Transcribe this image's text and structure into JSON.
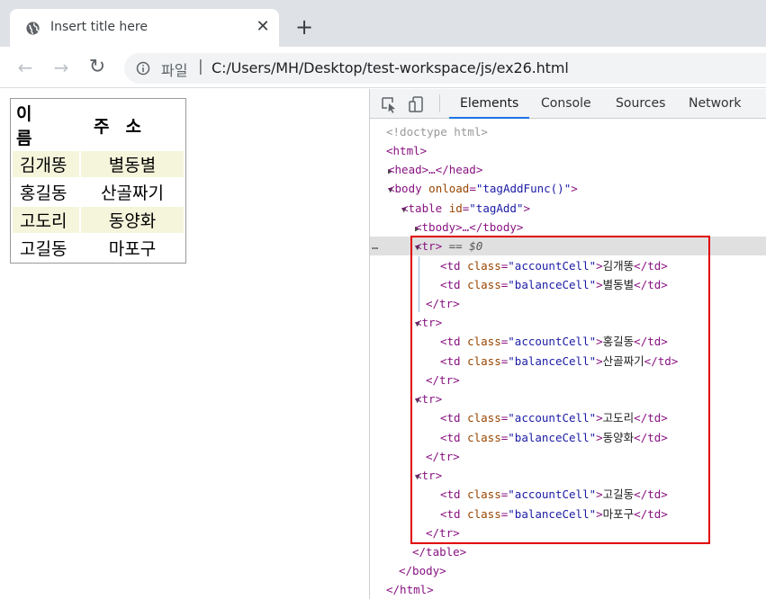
{
  "browser": {
    "tab_title": "Insert title here",
    "close_glyph": "✕",
    "newtab_glyph": "+",
    "back_glyph": "←",
    "forward_glyph": "→",
    "reload_glyph": "↻",
    "protocol_label": "파일",
    "separator": "|",
    "url": "C:/Users/MH/Desktop/test-workspace/js/ex26.html"
  },
  "page_table": {
    "headers": [
      "이름",
      "주소"
    ],
    "rows": [
      {
        "account": "김개똥",
        "balance": "별동별"
      },
      {
        "account": "홍길동",
        "balance": "산골짜기"
      },
      {
        "account": "고도리",
        "balance": "동양화"
      },
      {
        "account": "고길동",
        "balance": "마포구"
      }
    ]
  },
  "devtools": {
    "tabs": [
      "Elements",
      "Console",
      "Sources",
      "Network"
    ],
    "active_tab": "Elements",
    "dom": {
      "doctype": "<!doctype html>",
      "html_open": "<html>",
      "head": "<head>…</head>",
      "body_open_tag": "<body",
      "body_attr": "onload",
      "body_value": "\"tagAddFunc()\"",
      "table_open_tag": "<table",
      "table_attr": "id",
      "table_value": "\"tagAdd\"",
      "tbody": "<tbody>…</tbody>",
      "selected_marker": "== $0",
      "dots": "…",
      "tr_open": "<tr>",
      "tr_close": "</tr>",
      "td_open": "<td",
      "td_close": "</td>",
      "class_attr": "class",
      "account_class": "\"accountCell\"",
      "balance_class": "\"balanceCell\"",
      "table_close": "</table>",
      "body_close": "</body>",
      "html_close": "</html>"
    }
  },
  "colors": {
    "highlight_box": "#e10000",
    "alt_row_bg": "#f5f5dc",
    "active_tab_underline": "#1a73e8"
  }
}
